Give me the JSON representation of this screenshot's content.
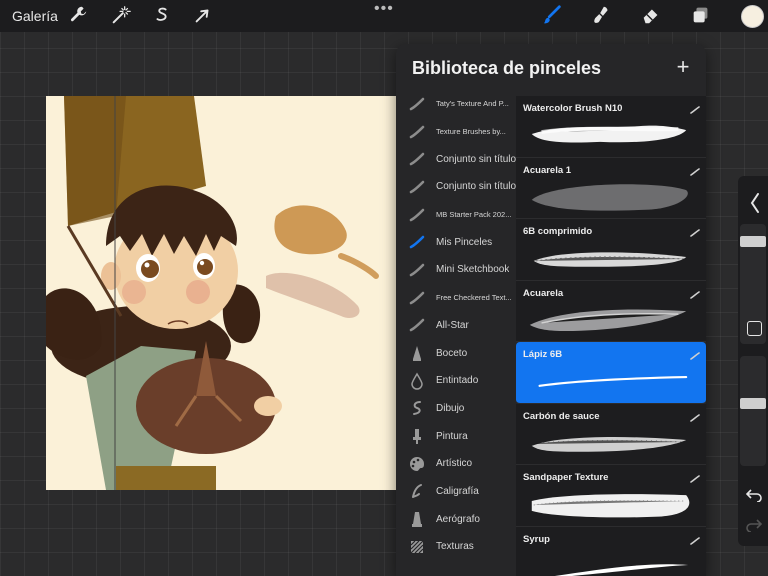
{
  "toolbar": {
    "gallery_label": "Galería",
    "more_label": "•••",
    "left_tools": [
      "wrench-icon",
      "magic-wand-icon",
      "selection-s-icon",
      "arrow-cursor-icon"
    ],
    "right_tools": [
      "brush-icon",
      "smudge-icon",
      "eraser-icon",
      "layers-icon",
      "color-swatch"
    ],
    "active_tool": "brush-icon",
    "accent": "#1275f0",
    "current_color": "#f6efe0"
  },
  "panel": {
    "title": "Biblioteca de pinceles",
    "add_label": "+",
    "sets": [
      {
        "label": "Taty's Texture And P...",
        "icon": "brush-stroke-icon",
        "size": "small"
      },
      {
        "label": "Texture Brushes by...",
        "icon": "brush-stroke-icon",
        "size": "small"
      },
      {
        "label": "Conjunto sin título",
        "icon": "brush-stroke-icon",
        "size": "med"
      },
      {
        "label": "Conjunto sin título",
        "icon": "brush-stroke-icon",
        "size": "med"
      },
      {
        "label": "MB Starter Pack 202...",
        "icon": "brush-stroke-icon",
        "size": "small"
      },
      {
        "label": "Mis Pinceles",
        "icon": "brush-stroke-icon",
        "size": "med",
        "active": true
      },
      {
        "label": "Mini Sketchbook",
        "icon": "brush-stroke-icon",
        "size": "med"
      },
      {
        "label": "Free Checkered Text...",
        "icon": "brush-stroke-icon",
        "size": "small"
      },
      {
        "label": "All-Star",
        "icon": "brush-stroke-icon",
        "size": "med"
      },
      {
        "label": "Boceto",
        "icon": "pencil-tip-icon",
        "size": "med"
      },
      {
        "label": "Entintado",
        "icon": "ink-drop-icon",
        "size": "med"
      },
      {
        "label": "Dibujo",
        "icon": "squiggle-icon",
        "size": "med"
      },
      {
        "label": "Pintura",
        "icon": "paint-brush-icon",
        "size": "med"
      },
      {
        "label": "Artístico",
        "icon": "palette-icon",
        "size": "med"
      },
      {
        "label": "Caligrafía",
        "icon": "calligraphy-icon",
        "size": "med"
      },
      {
        "label": "Aerógrafo",
        "icon": "airbrush-icon",
        "size": "med"
      },
      {
        "label": "Texturas",
        "icon": "texture-icon",
        "size": "med"
      }
    ],
    "brushes": [
      {
        "name": "Watercolor Brush N10",
        "style": "watercolor"
      },
      {
        "name": "Acuarela 1",
        "style": "wash"
      },
      {
        "name": "6B comprimido",
        "style": "grain"
      },
      {
        "name": "Acuarela",
        "style": "dry"
      },
      {
        "name": "Lápiz 6B",
        "style": "line",
        "active": true
      },
      {
        "name": "Carbón de sauce",
        "style": "charcoal"
      },
      {
        "name": "Sandpaper Texture",
        "style": "sand"
      },
      {
        "name": "Syrup",
        "style": "syrup"
      }
    ]
  },
  "sidebar": {
    "items": [
      "collapse-chevron-icon",
      "brush-size-slider",
      "modify-square-button",
      "opacity-slider",
      "undo-icon",
      "redo-icon"
    ]
  }
}
